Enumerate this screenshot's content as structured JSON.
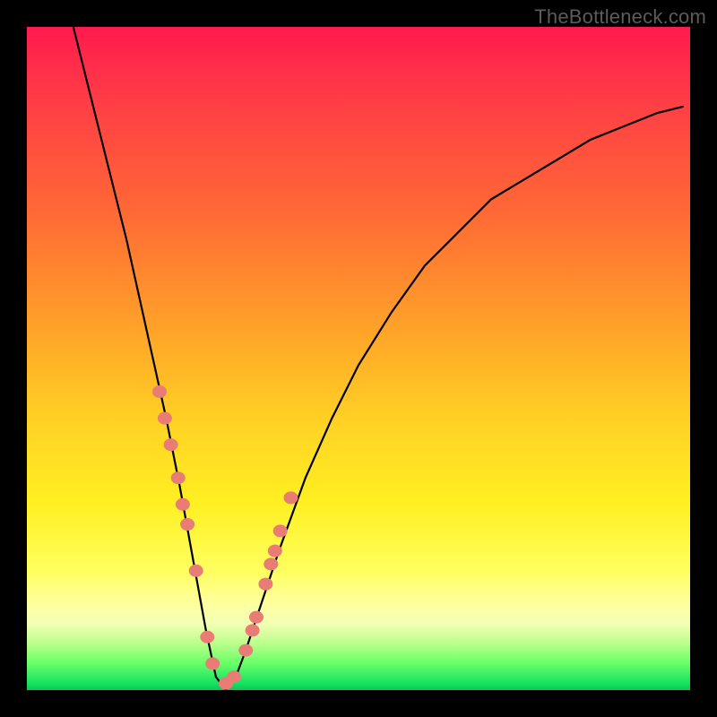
{
  "watermark": "TheBottleneck.com",
  "chart_data": {
    "type": "line",
    "title": "",
    "xlabel": "",
    "ylabel": "",
    "xlim": [
      0,
      100
    ],
    "ylim": [
      0,
      100
    ],
    "note": "V-shaped bottleneck curve over gradient background; y ~ 100 at edges, ~0 at trough ~x=29. Points below are (x, y) pairs estimated from pixels.",
    "series": [
      {
        "name": "curve",
        "x": [
          7,
          9,
          11,
          13,
          15,
          17,
          19,
          21,
          23,
          25,
          27,
          28.5,
          30,
          31.5,
          33,
          35,
          38,
          42,
          46,
          50,
          55,
          60,
          65,
          70,
          75,
          80,
          85,
          90,
          95,
          99
        ],
        "y": [
          100,
          92,
          84,
          76,
          68,
          59,
          50,
          41,
          31,
          20,
          9,
          2,
          0,
          2,
          6,
          12,
          21,
          32,
          41,
          49,
          57,
          64,
          69,
          74,
          77,
          80,
          83,
          85,
          87,
          88
        ]
      }
    ],
    "markers": {
      "note": "salmon-colored sample points clustered on lower arms and trough",
      "x": [
        20.0,
        20.8,
        21.7,
        22.8,
        23.5,
        24.2,
        25.5,
        27.2,
        28.0,
        30.0,
        31.2,
        33.0,
        34.0,
        34.6,
        36.0,
        36.8,
        37.4,
        38.2,
        39.8
      ],
      "y": [
        45,
        41,
        37,
        32,
        28,
        25,
        18,
        8,
        4,
        1,
        2,
        6,
        9,
        11,
        16,
        19,
        21,
        24,
        29
      ]
    },
    "gradient_stops": [
      {
        "pos": 0.0,
        "color": "#ff1a4e"
      },
      {
        "pos": 0.28,
        "color": "#ff6935"
      },
      {
        "pos": 0.6,
        "color": "#ffd324"
      },
      {
        "pos": 0.86,
        "color": "#ffff90"
      },
      {
        "pos": 0.96,
        "color": "#68ff68"
      },
      {
        "pos": 1.0,
        "color": "#0fc456"
      }
    ]
  }
}
